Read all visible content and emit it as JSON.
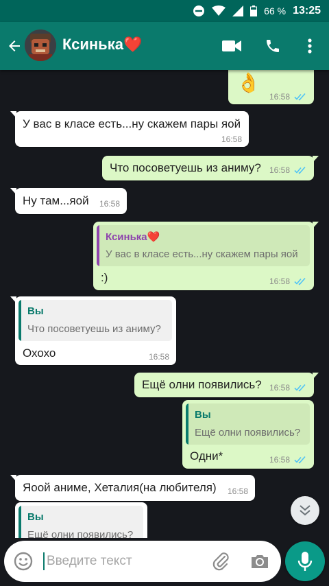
{
  "status_bar": {
    "battery_percent": "66 %",
    "time": "13:25",
    "battery_level": 0.66
  },
  "header": {
    "contact_name": "Ксинька❤️",
    "accent": "#0a7a6c"
  },
  "messages": [
    {
      "dir": "out",
      "emoji": "👌",
      "time": "16:58"
    },
    {
      "dir": "in",
      "text": "У вас в класе есть...ну скажем пары яой",
      "time": "16:58"
    },
    {
      "dir": "out",
      "text": "Что посоветуешь из аниму?",
      "time": "16:58"
    },
    {
      "dir": "in",
      "text": "Ну там...яой",
      "time": "16:58"
    },
    {
      "dir": "out",
      "quote_name": "Ксинька❤️",
      "quote_text": "У вас в класе есть...ну скажем пары яой",
      "text": ":)",
      "time": "16:58"
    },
    {
      "dir": "in",
      "quote_name": "Вы",
      "quote_text": "Что посоветуешь из аниму?",
      "text": "Охохо",
      "time": "16:58"
    },
    {
      "dir": "out",
      "text": "Ещё олни появились?",
      "time": "16:58"
    },
    {
      "dir": "out",
      "quote_name": "Вы",
      "quote_text": "Ещё олни появились?",
      "text": "Одни*",
      "time": "16:58"
    },
    {
      "dir": "in",
      "text": "Яоой аниме, Хеталия(на любителя)",
      "time": "16:58"
    },
    {
      "dir": "in",
      "quote_name": "Вы",
      "quote_text": "Ещё олни появились?"
    }
  ],
  "input": {
    "placeholder": "Введите текст"
  },
  "icons": {
    "back": "arrow-left-icon",
    "video": "video-call-icon",
    "call": "phone-icon",
    "menu": "more-vert-icon",
    "scroll": "double-chevron-down-icon",
    "emoji": "emoji-icon",
    "attach": "paperclip-icon",
    "camera": "camera-icon",
    "mic": "microphone-icon"
  },
  "colors": {
    "incoming_bubble": "#ffffff",
    "outgoing_bubble": "#dcf8c6",
    "read_ticks": "#4fc3f7",
    "quote_purple": "#8e44ad",
    "quote_teal": "#0a7a6c"
  }
}
